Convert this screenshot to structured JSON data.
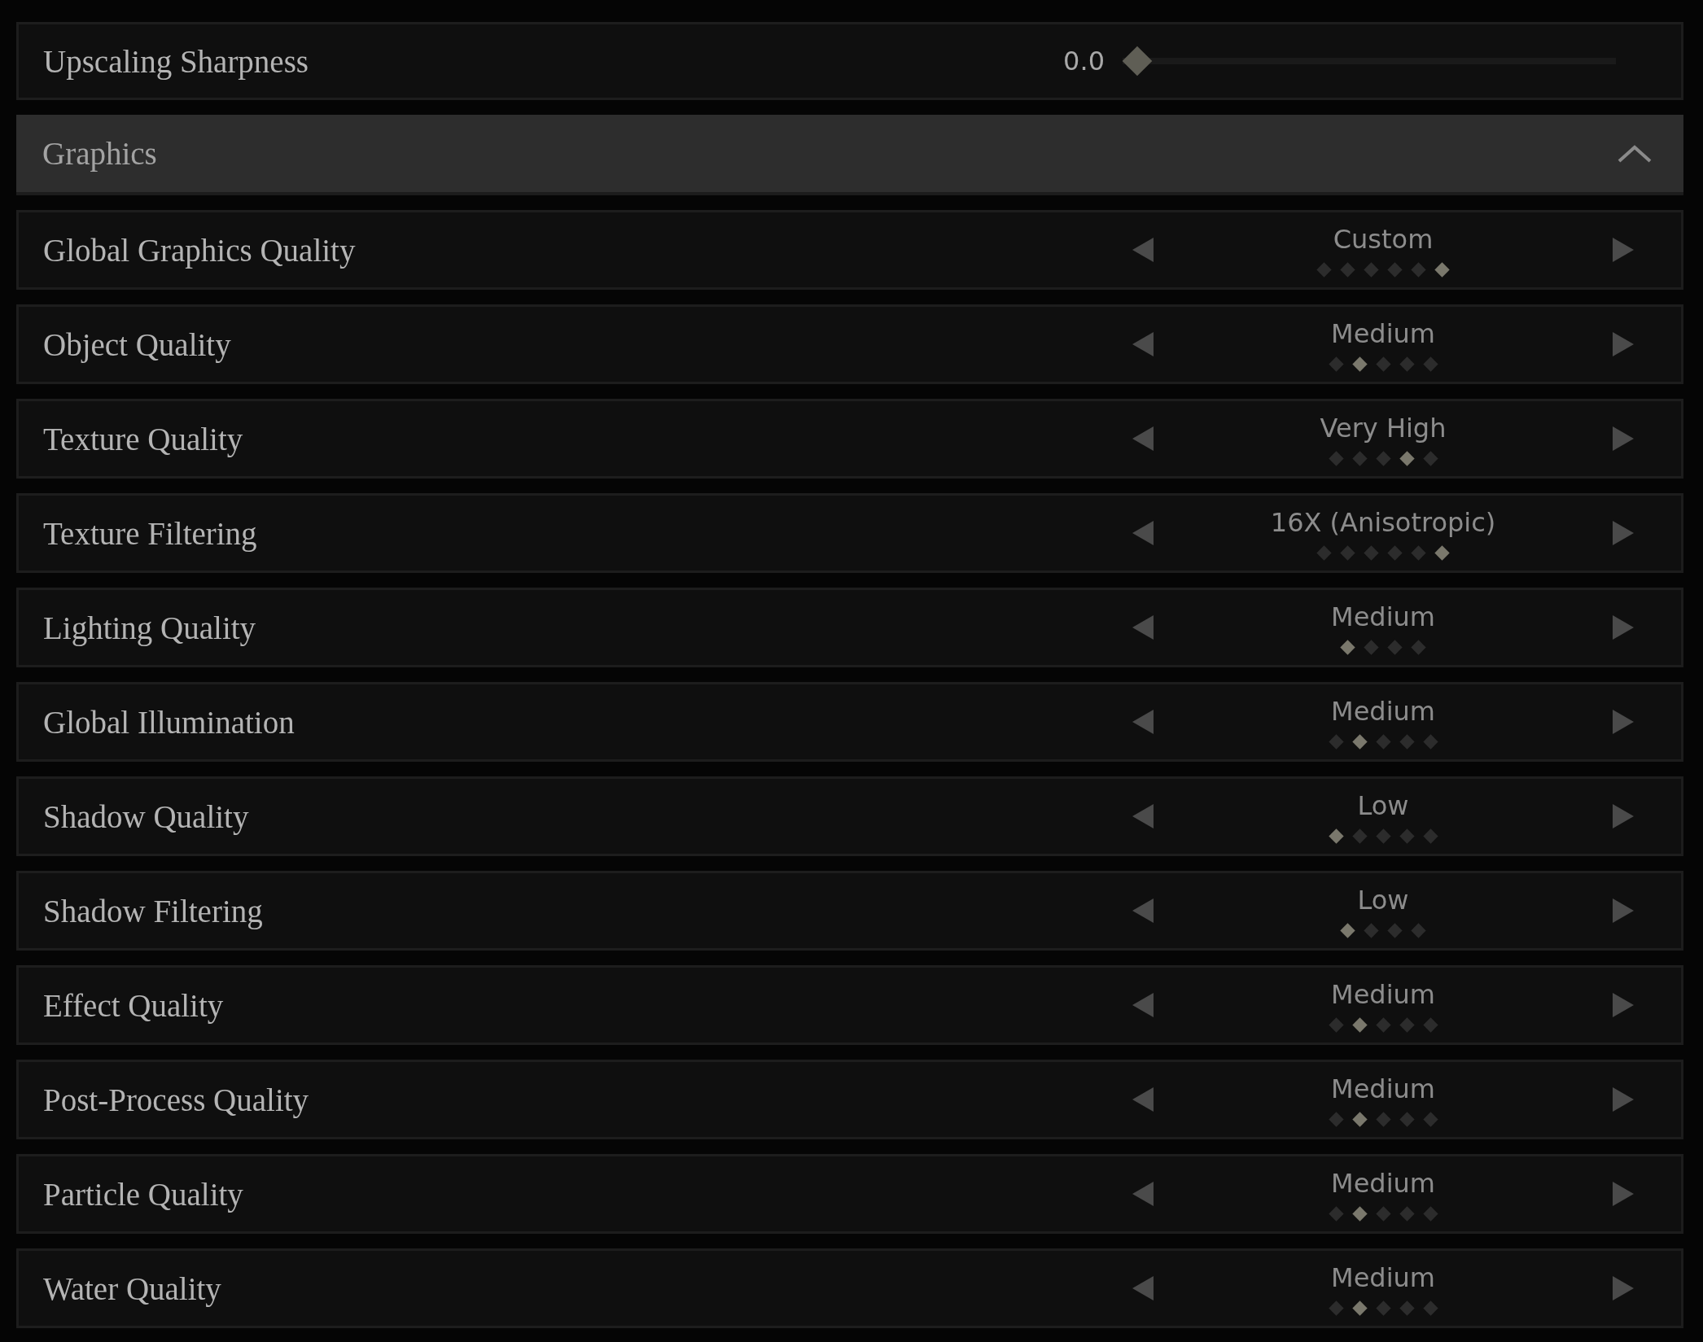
{
  "upscaling": {
    "label": "Upscaling Sharpness",
    "value": "0.0",
    "level": 0
  },
  "section": {
    "title": "Graphics",
    "expanded": true
  },
  "options": [
    {
      "label": "Global Graphics Quality",
      "value": "Custom",
      "steps": [
        {
          "selected": false
        },
        {
          "selected": false
        },
        {
          "selected": false
        },
        {
          "selected": false
        },
        {
          "selected": false
        },
        {
          "selected": true
        }
      ]
    },
    {
      "label": "Object Quality",
      "value": "Medium",
      "steps": [
        {
          "selected": false
        },
        {
          "selected": true
        },
        {
          "selected": false
        },
        {
          "selected": false
        },
        {
          "selected": false
        }
      ]
    },
    {
      "label": "Texture Quality",
      "value": "Very High",
      "steps": [
        {
          "selected": false
        },
        {
          "selected": false
        },
        {
          "selected": false
        },
        {
          "selected": true
        },
        {
          "selected": false
        }
      ]
    },
    {
      "label": "Texture Filtering",
      "value": "16X (Anisotropic)",
      "steps": [
        {
          "selected": false
        },
        {
          "selected": false
        },
        {
          "selected": false
        },
        {
          "selected": false
        },
        {
          "selected": false
        },
        {
          "selected": true
        }
      ]
    },
    {
      "label": "Lighting Quality",
      "value": "Medium",
      "steps": [
        {
          "selected": true
        },
        {
          "selected": false
        },
        {
          "selected": false
        },
        {
          "selected": false
        }
      ]
    },
    {
      "label": "Global Illumination",
      "value": "Medium",
      "steps": [
        {
          "selected": false
        },
        {
          "selected": true
        },
        {
          "selected": false
        },
        {
          "selected": false
        },
        {
          "selected": false
        }
      ]
    },
    {
      "label": "Shadow Quality",
      "value": "Low",
      "steps": [
        {
          "selected": true
        },
        {
          "selected": false
        },
        {
          "selected": false
        },
        {
          "selected": false
        },
        {
          "selected": false
        }
      ]
    },
    {
      "label": "Shadow Filtering",
      "value": "Low",
      "steps": [
        {
          "selected": true
        },
        {
          "selected": false
        },
        {
          "selected": false
        },
        {
          "selected": false
        }
      ]
    },
    {
      "label": "Effect Quality",
      "value": "Medium",
      "steps": [
        {
          "selected": false
        },
        {
          "selected": true
        },
        {
          "selected": false
        },
        {
          "selected": false
        },
        {
          "selected": false
        }
      ]
    },
    {
      "label": "Post-Process Quality",
      "value": "Medium",
      "steps": [
        {
          "selected": false
        },
        {
          "selected": true
        },
        {
          "selected": false
        },
        {
          "selected": false
        },
        {
          "selected": false
        }
      ]
    },
    {
      "label": "Particle Quality",
      "value": "Medium",
      "steps": [
        {
          "selected": false
        },
        {
          "selected": true
        },
        {
          "selected": false
        },
        {
          "selected": false
        },
        {
          "selected": false
        }
      ]
    },
    {
      "label": "Water Quality",
      "value": "Medium",
      "steps": [
        {
          "selected": false
        },
        {
          "selected": true
        },
        {
          "selected": false
        },
        {
          "selected": false
        },
        {
          "selected": false
        }
      ]
    }
  ]
}
